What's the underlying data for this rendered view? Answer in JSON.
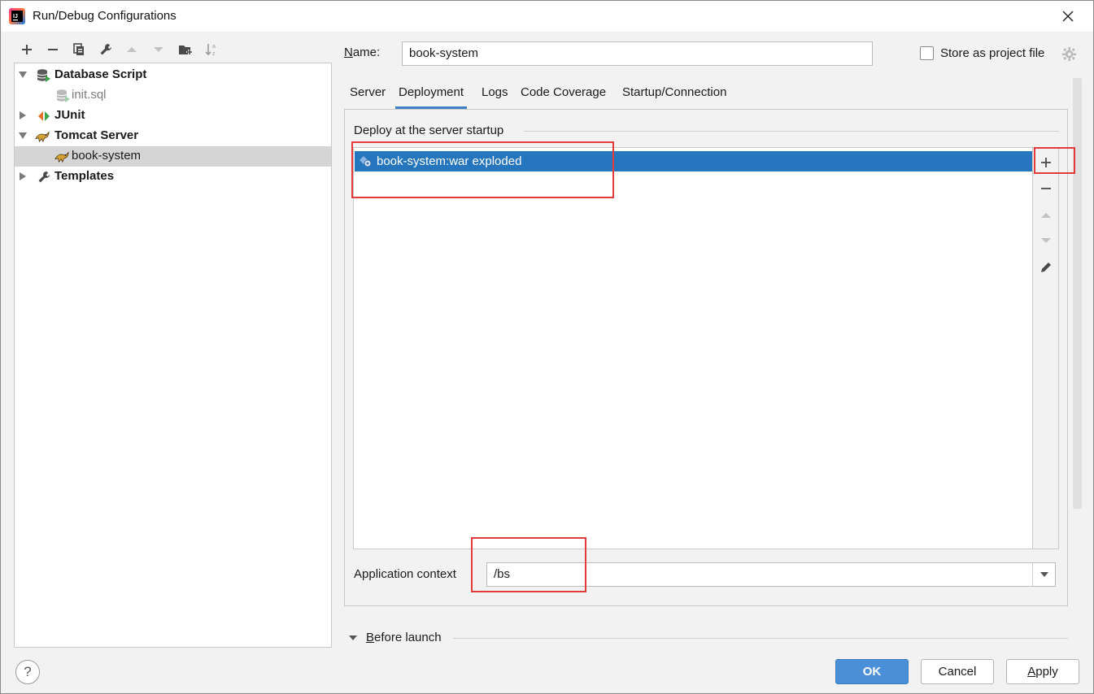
{
  "window": {
    "title": "Run/Debug Configurations"
  },
  "toolbar": {
    "icons": [
      "add-icon",
      "remove-icon",
      "copy-icon",
      "wrench-icon",
      "move-up-icon",
      "move-down-icon",
      "new-folder-icon",
      "sort-icon"
    ]
  },
  "tree": {
    "items": [
      {
        "label": "Database Script",
        "bold": true,
        "expanded": true
      },
      {
        "label": "init.sql",
        "bold": false,
        "muted": true
      },
      {
        "label": "JUnit",
        "bold": true,
        "expanded": false
      },
      {
        "label": "Tomcat Server",
        "bold": true,
        "expanded": true
      },
      {
        "label": "book-system",
        "bold": false,
        "selected": true
      },
      {
        "label": "Templates",
        "bold": true,
        "expanded": false
      }
    ]
  },
  "form": {
    "name_label": "Name:",
    "name_value": "book-system",
    "store_label": "Store as project file",
    "store_checked": false
  },
  "tabs": [
    {
      "label": "Server",
      "active": false
    },
    {
      "label": "Deployment",
      "active": true
    },
    {
      "label": "Logs",
      "active": false
    },
    {
      "label": "Code Coverage",
      "active": false
    },
    {
      "label": "Startup/Connection",
      "active": false
    }
  ],
  "deployment": {
    "section_title": "Deploy at the server startup",
    "items": [
      {
        "label": "book-system:war exploded",
        "selected": true
      }
    ],
    "side_icons": [
      "add-icon",
      "remove-icon",
      "move-up-icon",
      "move-down-icon",
      "edit-icon"
    ],
    "context_label": "Application context",
    "context_value": "/bs"
  },
  "before_launch": {
    "label": "Before launch",
    "expanded": false
  },
  "buttons": {
    "ok": "OK",
    "cancel": "Cancel",
    "apply": "Apply",
    "help": "?"
  },
  "colors": {
    "selection": "#2675bf",
    "primary_button": "#4b8fd8",
    "annotation": "#e53a3a"
  }
}
